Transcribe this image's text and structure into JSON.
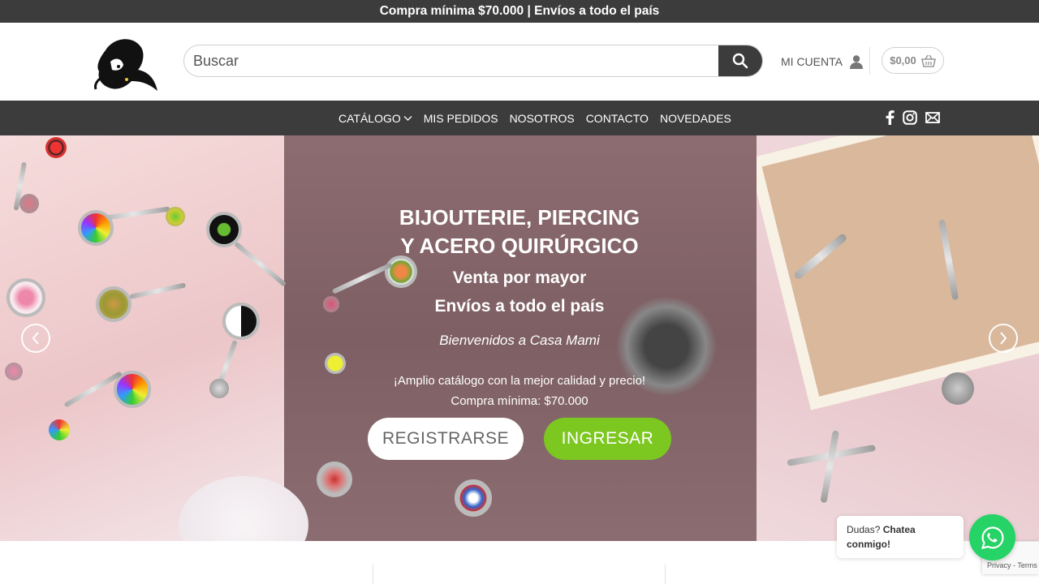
{
  "topbar": {
    "text": "Compra mínima $70.000 | Envíos a todo el país"
  },
  "header": {
    "logo_alt": "Casa Mami",
    "search_placeholder": "Buscar",
    "account_label": "MI CUENTA",
    "cart_total": "$0,00"
  },
  "nav": {
    "items": [
      "CATÁLOGO",
      "MIS PEDIDOS",
      "NOSOTROS",
      "CONTACTO",
      "NOVEDADES"
    ],
    "social_icons": [
      "facebook-icon",
      "instagram-icon",
      "email-icon"
    ]
  },
  "hero": {
    "title_line1": "BIJOUTERIE, PIERCING",
    "title_line2": "Y ACERO QUIRÚRGICO",
    "subtitle_line1": "Venta por mayor",
    "subtitle_line2": "Envíos a todo el país",
    "welcome": "Bienvenidos a Casa Mami",
    "desc_line1": "¡Amplio catálogo con la mejor calidad y precio!",
    "desc_line2": "Compra mínima: $70.000",
    "register_label": "REGISTRARSE",
    "login_label": "INGRESAR"
  },
  "chat": {
    "prefix": "Dudas?",
    "strong": "Chatea conmigo!"
  },
  "recaptcha": {
    "text": "Privacy - Terms"
  },
  "colors": {
    "dark_bar": "#3c3c3c",
    "accent_green": "#7dc721",
    "whatsapp_green": "#25d366"
  }
}
